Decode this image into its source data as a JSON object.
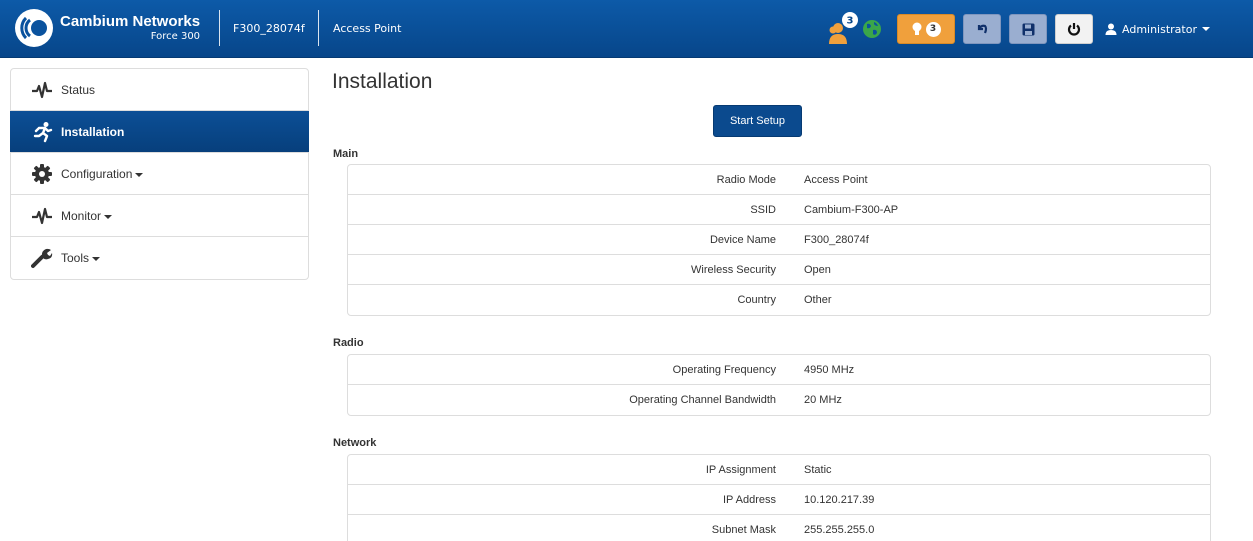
{
  "app": {
    "brand_name": "Cambium Networks",
    "model": "Force 300",
    "device_id": "F300_28074f",
    "mode": "Access Point"
  },
  "toolbar": {
    "notification_count": "3",
    "alert_count": "3",
    "user_label": "Administrator",
    "icons": [
      "users-icon",
      "globe-icon",
      "lightbulb-icon",
      "undo-icon",
      "save-icon",
      "power-icon",
      "user-icon"
    ],
    "colors": {
      "header": "#0a529e",
      "alert": "#f0a03c",
      "action": "#9aaed0",
      "globe": "#3aa64a"
    }
  },
  "sidebar": {
    "items": [
      {
        "label": "Status",
        "icon": "pulse-icon",
        "dropdown": false,
        "active": false
      },
      {
        "label": "Installation",
        "icon": "runner-icon",
        "dropdown": false,
        "active": true
      },
      {
        "label": "Configuration",
        "icon": "gear-icon",
        "dropdown": true,
        "active": false
      },
      {
        "label": "Monitor",
        "icon": "pulse-icon",
        "dropdown": true,
        "active": false
      },
      {
        "label": "Tools",
        "icon": "wrench-icon",
        "dropdown": true,
        "active": false
      }
    ]
  },
  "main": {
    "title": "Installation",
    "start_setup_label": "Start Setup",
    "sections": [
      {
        "title": "Main",
        "rows": [
          {
            "label": "Radio Mode",
            "value": "Access Point"
          },
          {
            "label": "SSID",
            "value": "Cambium-F300-AP"
          },
          {
            "label": "Device Name",
            "value": "F300_28074f"
          },
          {
            "label": "Wireless Security",
            "value": "Open"
          },
          {
            "label": "Country",
            "value": "Other"
          }
        ]
      },
      {
        "title": "Radio",
        "rows": [
          {
            "label": "Operating Frequency",
            "value": "4950 MHz"
          },
          {
            "label": "Operating Channel Bandwidth",
            "value": "20 MHz"
          }
        ]
      },
      {
        "title": "Network",
        "rows": [
          {
            "label": "IP Assignment",
            "value": "Static"
          },
          {
            "label": "IP Address",
            "value": "10.120.217.39"
          },
          {
            "label": "Subnet Mask",
            "value": "255.255.255.0"
          }
        ]
      }
    ]
  }
}
